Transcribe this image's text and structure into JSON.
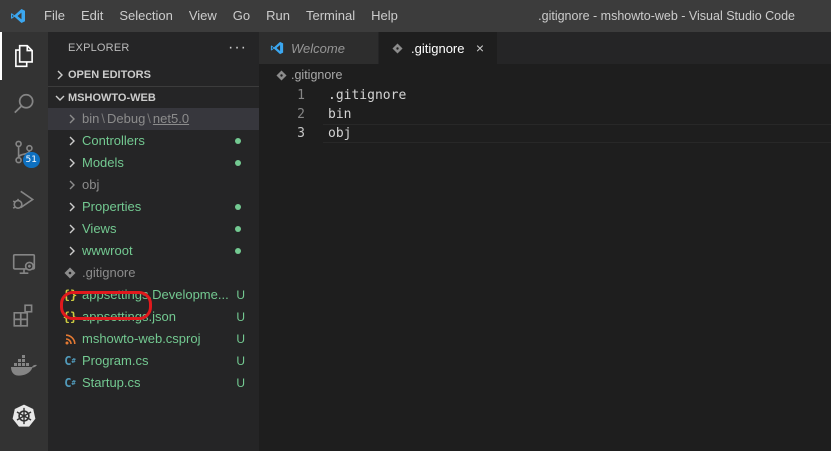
{
  "titlebar": {
    "logo_icon": "vscode-logo-icon",
    "menu": [
      "File",
      "Edit",
      "Selection",
      "View",
      "Go",
      "Run",
      "Terminal",
      "Help"
    ],
    "window_title": ".gitignore - mshowto-web - Visual Studio Code"
  },
  "activity_bar": {
    "items": [
      {
        "name": "explorer-icon",
        "active": true
      },
      {
        "name": "search-icon",
        "active": false
      },
      {
        "name": "source-control-icon",
        "active": false,
        "badge": "51"
      },
      {
        "name": "run-debug-icon",
        "active": false
      },
      {
        "name": "remote-explorer-icon",
        "active": false
      },
      {
        "name": "extensions-icon",
        "active": false
      },
      {
        "name": "docker-icon",
        "active": false
      },
      {
        "name": "kubernetes-icon",
        "active": false
      }
    ]
  },
  "sidebar": {
    "title": "EXPLORER",
    "more": "···",
    "open_editors": "OPEN EDITORS",
    "project": "MSHOWTO-WEB",
    "compact_folder": {
      "part1": "bin",
      "sep1": "\\",
      "part2": "Debug",
      "sep2": "\\",
      "part3": "net5.0"
    },
    "tree": [
      {
        "label": "Controllers",
        "type": "folder",
        "color": "#73c991",
        "dot": true
      },
      {
        "label": "Models",
        "type": "folder",
        "color": "#73c991",
        "dot": true
      },
      {
        "label": "obj",
        "type": "folder",
        "color": "#8c8c8c",
        "dot": false
      },
      {
        "label": "Properties",
        "type": "folder",
        "color": "#73c991",
        "dot": true
      },
      {
        "label": "Views",
        "type": "folder",
        "color": "#73c991",
        "dot": true
      },
      {
        "label": "wwwroot",
        "type": "folder",
        "color": "#73c991",
        "dot": true
      },
      {
        "label": ".gitignore",
        "type": "file",
        "icon": "git-file-icon",
        "color": "#8c8c8c",
        "status": ""
      },
      {
        "label": "appsettings.Developme...",
        "type": "file",
        "icon": "json-braces-icon",
        "color": "#73c991",
        "status": "U"
      },
      {
        "label": "appsettings.json",
        "type": "file",
        "icon": "json-braces-icon",
        "color": "#73c991",
        "status": "U"
      },
      {
        "label": "mshowto-web.csproj",
        "type": "file",
        "icon": "rss-xml-icon",
        "color": "#73c991",
        "status": "U"
      },
      {
        "label": "Program.cs",
        "type": "file",
        "icon": "csharp-icon",
        "color": "#73c991",
        "status": "U"
      },
      {
        "label": "Startup.cs",
        "type": "file",
        "icon": "csharp-icon",
        "color": "#73c991",
        "status": "U"
      }
    ]
  },
  "editor": {
    "tabs": [
      {
        "label": "Welcome",
        "active": false,
        "icon": "vscode-logo-icon"
      },
      {
        "label": ".gitignore",
        "active": true,
        "icon": "git-file-icon",
        "close": "×"
      }
    ],
    "breadcrumb": ".gitignore",
    "lines": [
      {
        "num": "1",
        "text": ".gitignore"
      },
      {
        "num": "2",
        "text": "bin"
      },
      {
        "num": "3",
        "text": "obj",
        "current": true
      }
    ]
  },
  "colors": {
    "accent": "#007acc",
    "untracked_green": "#73c991",
    "ignored_gray": "#8c8c8c",
    "highlight_red": "#e0191d",
    "badge_blue": "#0e70c0"
  }
}
